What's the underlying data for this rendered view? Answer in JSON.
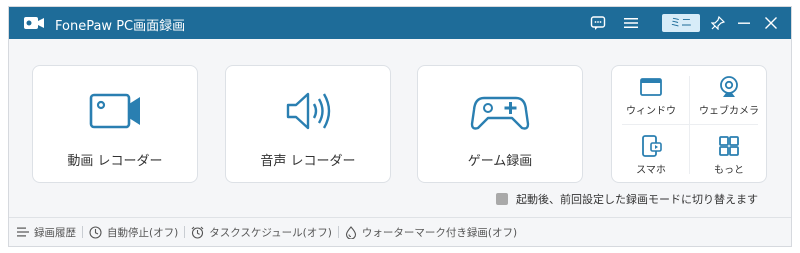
{
  "app": {
    "title": "FonePaw PC画面録画",
    "mini_label": "ミニ"
  },
  "titlebar_icons": [
    "chat-icon",
    "menu-icon",
    "pin-icon",
    "minimize-icon",
    "close-icon"
  ],
  "cards": [
    {
      "label": "動画 レコーダー",
      "icon": "video-camera-icon"
    },
    {
      "label": "音声 レコーダー",
      "icon": "speaker-icon"
    },
    {
      "label": "ゲーム録画",
      "icon": "gamepad-icon"
    }
  ],
  "tools": [
    {
      "label": "ウィンドウ",
      "icon": "window-icon"
    },
    {
      "label": "ウェブカメラ",
      "icon": "webcam-icon"
    },
    {
      "label": "スマホ",
      "icon": "phone-icon"
    },
    {
      "label": "もっと",
      "icon": "more-grid-icon"
    }
  ],
  "switch_text": "起動後、前回設定した録画モードに切り替えます",
  "footer": {
    "history": "録画履歴",
    "auto_stop": "自動停止(オフ)",
    "schedule": "タスクスケジュール(オフ)",
    "watermark": "ウォーターマーク付き録画(オフ)"
  },
  "colors": {
    "accent": "#1e6c99",
    "icon_blue": "#2a7fb1",
    "mini_bg": "#d7ecf8"
  }
}
